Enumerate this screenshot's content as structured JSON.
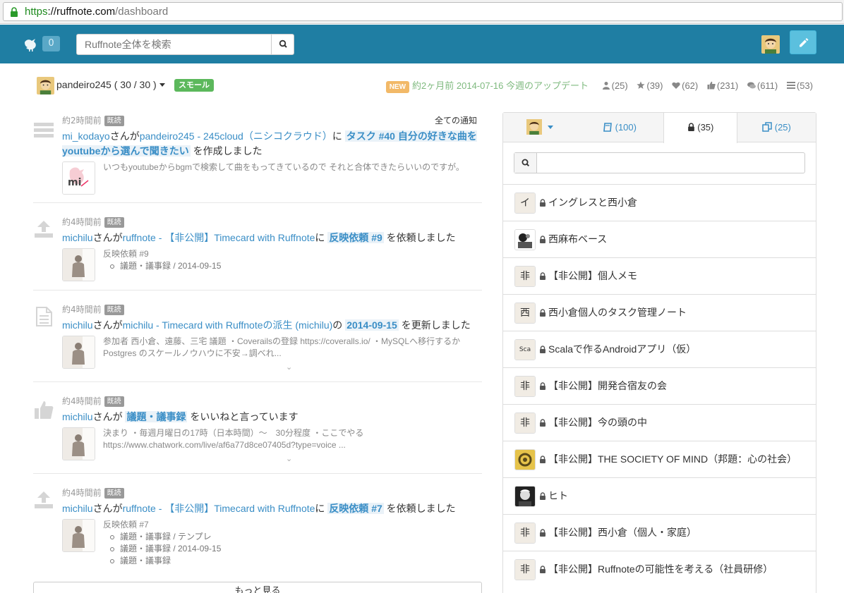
{
  "browser": {
    "url_scheme": "https",
    "url_host": "://ruffnote.com",
    "url_path": "/dashboard"
  },
  "navbar": {
    "notification_count": "0",
    "search_placeholder": "Ruffnote全体を検索",
    "accent": "#1f7ea3"
  },
  "userbar": {
    "username": "pandeiro245 ( 30 / 30 )",
    "plan": "スモール",
    "new_label": "NEW",
    "update_text": "約2ヶ月前 2014-07-16 今週のアップデート",
    "stats": [
      "(25)",
      "(39)",
      "(62)",
      "(231)",
      "(611)",
      "(53)"
    ]
  },
  "feed": {
    "all_notifications": "全ての通知",
    "read_label": "既読",
    "more_label": "もっと見る",
    "items": [
      {
        "time": "約2時間前",
        "actor": "mi_kodayo",
        "mid1": "さんが",
        "target": "pandeiro245 - 245cloud（ニシコクラウド）",
        "mid2": "に ",
        "highlight": "タスク #40 自分の好きな曲をyoutubeから選んで聞きたい",
        "tail": " を作成しました",
        "snippet": "いつもyoutubeからbgmで検索して曲をもってきているので それと合体できたらいいのですが。"
      },
      {
        "time": "約4時間前",
        "actor": "michilu",
        "mid1": "さんが",
        "target": "ruffnote - 【非公開】Timecard with Ruffnote",
        "mid2": "に ",
        "highlight": "反映依頼 #9",
        "tail": " を依頼しました",
        "snippet_title": "反映依頼 #9",
        "bullets": [
          "議題・議事録 / 2014-09-15"
        ]
      },
      {
        "time": "約4時間前",
        "actor": "michilu",
        "mid1": "さんが",
        "target": "michilu - Timecard with Ruffnoteの派生 (michilu)",
        "mid2": "の ",
        "highlight": "2014-09-15",
        "tail": " を更新しました",
        "snippet": "参加者 西小倉、遠藤、三宅 議題 ・Coverailsの登録 https://coveralls.io/ ・MySQLへ移行するか Postgres のスケールノウハウに不安→調べれ..."
      },
      {
        "time": "約4時間前",
        "actor": "michilu",
        "mid1": "さんが ",
        "target": "",
        "mid2": "",
        "highlight": "議題・議事録",
        "tail": " をいいねと言っています",
        "snippet": "決まり ・毎週月曜日の17時（日本時間）〜　30分程度 ・ここでやるhttps://www.chatwork.com/live/af6a77d8ce07405d?type=voice ..."
      },
      {
        "time": "約4時間前",
        "actor": "michilu",
        "mid1": "さんが",
        "target": "ruffnote - 【非公開】Timecard with Ruffnote",
        "mid2": "に ",
        "highlight": "反映依頼 #7",
        "tail": " を依頼しました",
        "snippet_title": "反映依頼 #7",
        "bullets": [
          "議題・議事録 / テンプレ",
          "議題・議事録 / 2014-09-15",
          "議題・議事録"
        ]
      }
    ]
  },
  "panel": {
    "tabs": [
      "(100)",
      "(35)",
      "(25)"
    ],
    "notebooks": [
      {
        "thumb": "イ",
        "title": "イングレスと西小倉"
      },
      {
        "thumb": "",
        "title": "西麻布ベース"
      },
      {
        "thumb": "非",
        "title": "【非公開】個人メモ"
      },
      {
        "thumb": "西",
        "title": "西小倉個人のタスク管理ノート"
      },
      {
        "thumb": "Sca",
        "title": "Scalaで作るAndroidアプリ（仮）"
      },
      {
        "thumb": "非",
        "title": "【非公開】開発合宿友の会"
      },
      {
        "thumb": "非",
        "title": "【非公開】今の頭の中"
      },
      {
        "thumb": "",
        "title": "【非公開】THE SOCIETY OF MIND（邦題：心の社会）"
      },
      {
        "thumb": "",
        "title": "ヒト"
      },
      {
        "thumb": "非",
        "title": "【非公開】西小倉（個人・家庭）"
      },
      {
        "thumb": "非",
        "title": "【非公開】Ruffnoteの可能性を考える（社員研修）"
      }
    ]
  }
}
